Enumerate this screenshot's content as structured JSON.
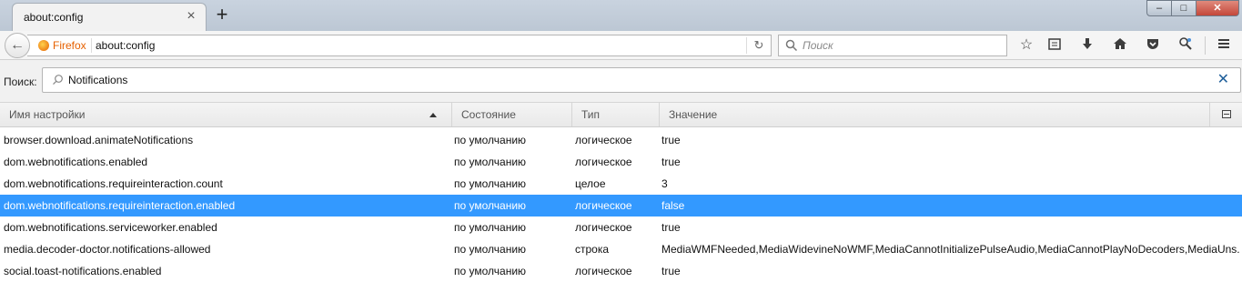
{
  "tab": {
    "title": "about:config"
  },
  "navbar": {
    "identity_label": "Firefox",
    "url": "about:config",
    "search_placeholder": "Поиск"
  },
  "filter": {
    "label": "Поиск:",
    "value": "Notifications"
  },
  "columns": {
    "name": "Имя настройки",
    "status": "Состояние",
    "type": "Тип",
    "value": "Значение"
  },
  "rows": [
    {
      "name": "browser.download.animateNotifications",
      "status": "по умолчанию",
      "type": "логическое",
      "value": "true",
      "selected": false
    },
    {
      "name": "dom.webnotifications.enabled",
      "status": "по умолчанию",
      "type": "логическое",
      "value": "true",
      "selected": false
    },
    {
      "name": "dom.webnotifications.requireinteraction.count",
      "status": "по умолчанию",
      "type": "целое",
      "value": "3",
      "selected": false
    },
    {
      "name": "dom.webnotifications.requireinteraction.enabled",
      "status": "по умолчанию",
      "type": "логическое",
      "value": "false",
      "selected": true
    },
    {
      "name": "dom.webnotifications.serviceworker.enabled",
      "status": "по умолчанию",
      "type": "логическое",
      "value": "true",
      "selected": false
    },
    {
      "name": "media.decoder-doctor.notifications-allowed",
      "status": "по умолчанию",
      "type": "строка",
      "value": "MediaWMFNeeded,MediaWidevineNoWMF,MediaCannotInitializePulseAudio,MediaCannotPlayNoDecoders,MediaUns...",
      "selected": false
    },
    {
      "name": "social.toast-notifications.enabled",
      "status": "по умолчанию",
      "type": "логическое",
      "value": "true",
      "selected": false
    }
  ],
  "colors": {
    "selection": "#3399ff",
    "firefox_orange": "#e66000"
  },
  "icons": {
    "toolbar": [
      "bookmark-star-icon",
      "reading-list-icon",
      "downloads-icon",
      "home-icon",
      "pocket-icon",
      "webext-icon",
      "hamburger-menu-icon"
    ]
  }
}
